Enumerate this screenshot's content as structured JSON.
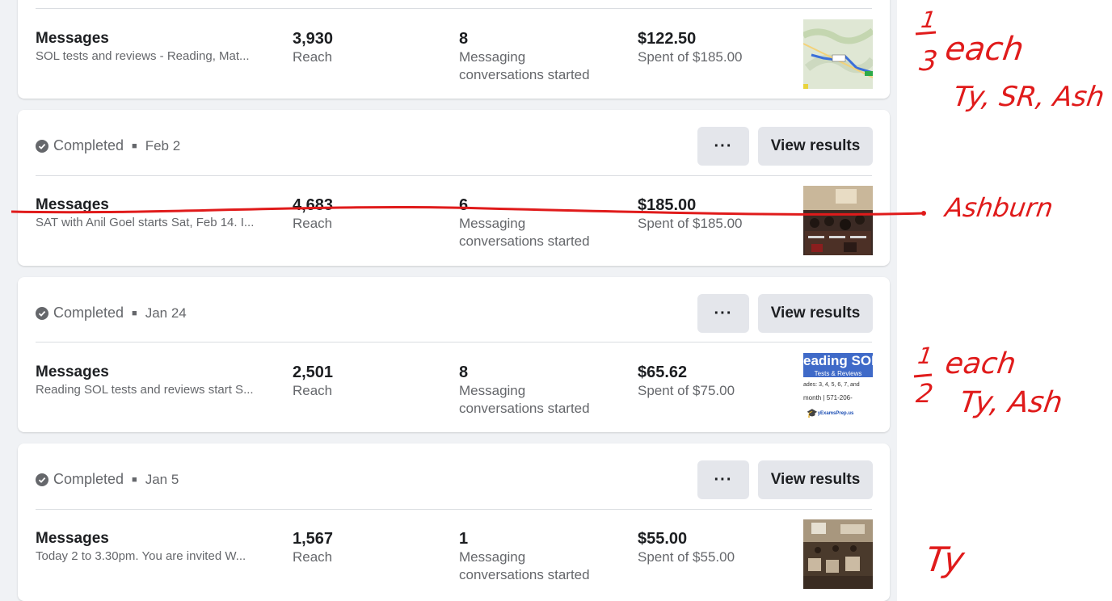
{
  "cards": [
    {
      "status": "",
      "date": "",
      "objective": "Messages",
      "description": "SOL tests and reviews - Reading, Mat...",
      "reach_value": "3,930",
      "reach_label": "Reach",
      "results_value": "8",
      "results_label_1": "Messaging",
      "results_label_2": "conversations started",
      "spent_value": "$122.50",
      "spent_label": "Spent of $185.00"
    },
    {
      "status": "Completed",
      "date": "Feb 2",
      "more_label": "···",
      "view_label": "View results",
      "objective": "Messages",
      "description": "SAT with Anil Goel starts Sat, Feb 14. I...",
      "reach_value": "4,683",
      "reach_label": "Reach",
      "results_value": "6",
      "results_label_1": "Messaging",
      "results_label_2": "conversations started",
      "spent_value": "$185.00",
      "spent_label": "Spent of $185.00"
    },
    {
      "status": "Completed",
      "date": "Jan 24",
      "more_label": "···",
      "view_label": "View results",
      "objective": "Messages",
      "description": "Reading SOL tests and reviews start S...",
      "reach_value": "2,501",
      "reach_label": "Reach",
      "results_value": "8",
      "results_label_1": "Messaging",
      "results_label_2": "conversations started",
      "spent_value": "$65.62",
      "spent_label": "Spent of $75.00",
      "thumb_text_1": "eading SOL",
      "thumb_text_2": "Tests & Reviews",
      "thumb_text_3": "ades: 3, 4, 5, 6, 7, and",
      "thumb_text_4": "month  | 571-206-",
      "thumb_text_5": "yExamsPrep.us"
    },
    {
      "status": "Completed",
      "date": "Jan 5",
      "more_label": "···",
      "view_label": "View results",
      "objective": "Messages",
      "description": "Today 2 to 3.30pm. You are invited W...",
      "reach_value": "1,567",
      "reach_label": "Reach",
      "results_value": "1",
      "results_label_1": "Messaging",
      "results_label_2": "conversations started",
      "spent_value": "$55.00",
      "spent_label": "Spent of $55.00"
    }
  ],
  "annotations": {
    "frac1_num": "1",
    "frac1_den": "3",
    "each_1": "each",
    "names_1": "Ty, SR, Ash",
    "ashburn": "Ashburn",
    "frac2_num": "1",
    "frac2_den": "2",
    "each_2": "each",
    "names_2": "Ty, Ash",
    "ty": "Ty"
  },
  "colors": {
    "annotation": "#e01b1b",
    "button_bg": "#e4e6eb",
    "page_bg": "#f0f2f5"
  }
}
